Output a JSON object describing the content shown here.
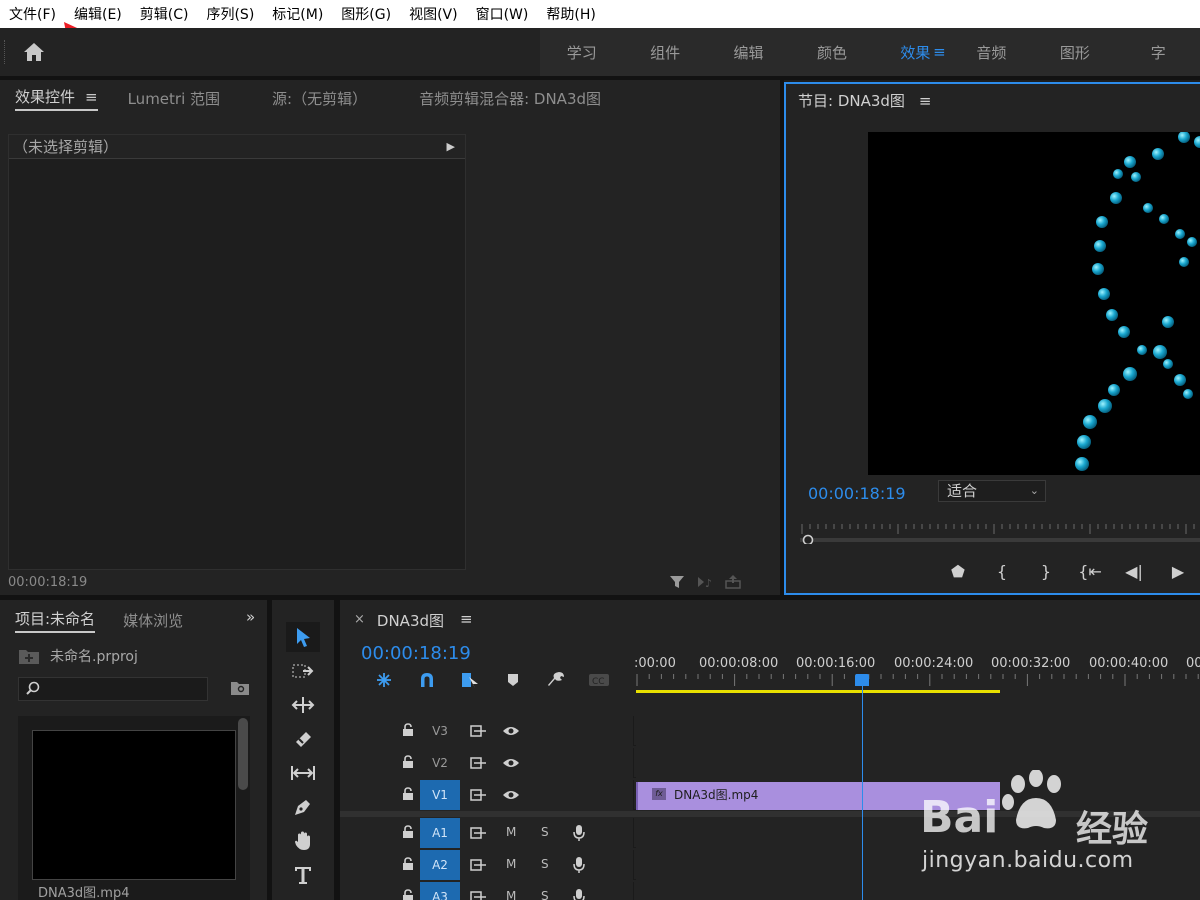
{
  "menu": [
    "文件(F)",
    "编辑(E)",
    "剪辑(C)",
    "序列(S)",
    "标记(M)",
    "图形(G)",
    "视图(V)",
    "窗口(W)",
    "帮助(H)"
  ],
  "workspaces": {
    "tabs": [
      "学习",
      "组件",
      "编辑",
      "颜色",
      "效果",
      "音频",
      "图形",
      "字"
    ],
    "active": "效果"
  },
  "effect_panel": {
    "tabs": [
      "效果控件",
      "Lumetri 范围",
      "源:（无剪辑）",
      "音频剪辑混合器: DNA3d图"
    ],
    "no_clip": "（未选择剪辑）",
    "timecode": "00:00:18:19"
  },
  "program": {
    "title": "节目: DNA3d图",
    "timecode": "00:00:18:19",
    "fit": "适合"
  },
  "project": {
    "tabs": [
      "项目:未命名",
      "媒体浏览"
    ],
    "file": "未命名.prproj",
    "clip_label": "DNA3d图.mp4"
  },
  "timeline": {
    "sequence": "DNA3d图",
    "timecode": "00:00:18:19",
    "ruler": [
      ":00:00",
      "00:00:08:00",
      "00:00:16:00",
      "00:00:24:00",
      "00:00:32:00",
      "00:00:40:00",
      "00"
    ],
    "video_tracks": [
      "V3",
      "V2",
      "V1"
    ],
    "audio_tracks": [
      "A1",
      "A2",
      "A3"
    ],
    "audio_m": "M",
    "audio_s": "S",
    "clip": "DNA3d图.mp4",
    "clip_fx": "fx"
  },
  "watermark": {
    "brand": "Bai",
    "brand_cn": "经验",
    "url": "jingyan.baidu.com"
  },
  "colors": {
    "accent": "#2d8ceb",
    "clip": "#a98fde",
    "work_area": "#e8e000",
    "track_active": "#1d6ab0"
  }
}
